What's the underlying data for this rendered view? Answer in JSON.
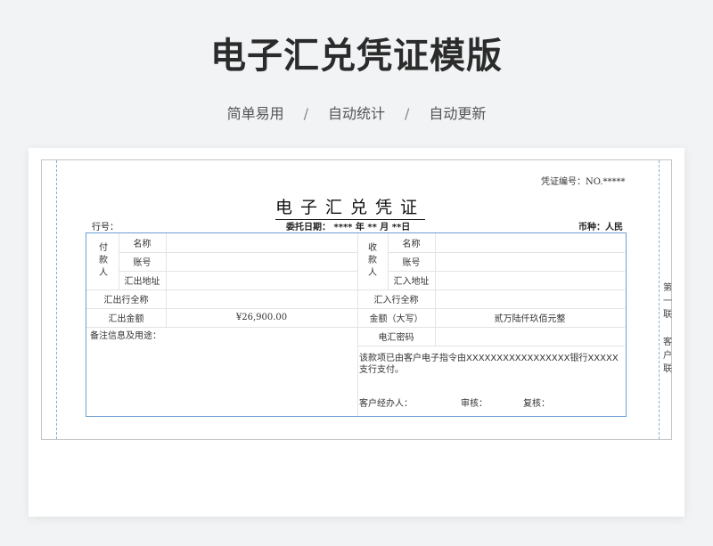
{
  "hero": {
    "title": "电子汇兑凭证模版",
    "tags": [
      "简单易用",
      "自动统计",
      "自动更新"
    ],
    "separator": "/"
  },
  "voucher": {
    "number": "凭证编号：NO.*****",
    "title": "电子汇兑凭证",
    "bank_label": "行号：",
    "date_label": "委托日期：  **** 年 ** 月 **日",
    "currency_label": "币种：人民",
    "payer": {
      "group_label": "付款人",
      "name_label": "名称",
      "account_label": "账号",
      "address_label": "汇出地址",
      "bank_label": "汇出行全称",
      "amount_label": "汇出金额",
      "amount_value": "¥26,900.00"
    },
    "payee": {
      "group_label": "收款人",
      "name_label": "名称",
      "account_label": "账号",
      "address_label": "汇入地址",
      "bank_label": "汇入行全称",
      "amount_caps_label": "金额（大写）",
      "amount_caps_value": "贰万陆仟玖佰元整",
      "password_label": "电汇密码"
    },
    "remarks_label": "备注信息及用途：",
    "instruction": "该款项已由客户电子指令由XXXXXXXXXXXXXXXXX银行XXXXX支行支付。",
    "footer": {
      "manager": "客户经办人：",
      "audit": "审核：",
      "recheck": "复核："
    },
    "side": {
      "copy_no": "第一联",
      "copy_type": "客户联"
    }
  }
}
